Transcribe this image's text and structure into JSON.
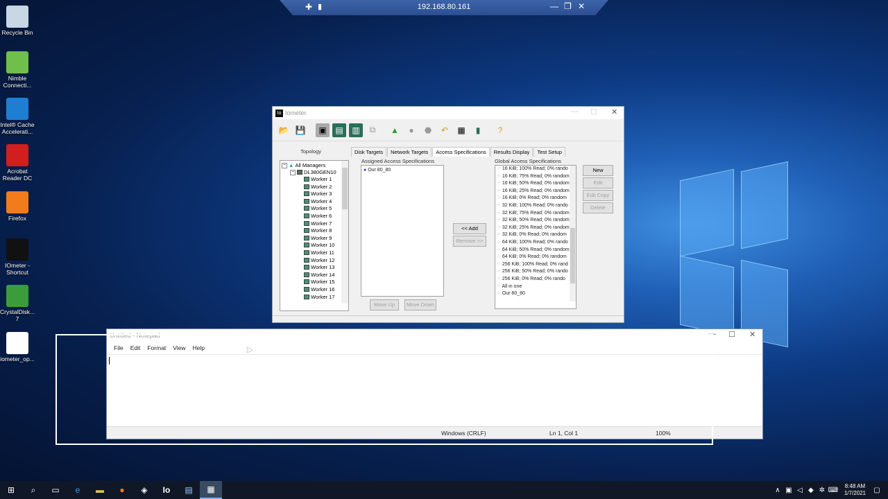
{
  "remote_bar": {
    "ip": "192.168.80.161",
    "pin_icon": "pin-icon",
    "signal_icon": "signal-icon"
  },
  "desktop_icons": [
    {
      "label": "Recycle Bin",
      "icon": "recycle-bin-icon",
      "color": "#c9d6e3"
    },
    {
      "label": "Nimble Connecti...",
      "icon": "nimble-icon",
      "color": "#6fbf4a"
    },
    {
      "label": "Intel® Cache Accelerati...",
      "icon": "intel-icon",
      "color": "#1e7fd2"
    },
    {
      "label": "Acrobat Reader DC",
      "icon": "acrobat-icon",
      "color": "#d11e1e"
    },
    {
      "label": "Firefox",
      "icon": "firefox-icon",
      "color": "#f27c1b"
    },
    {
      "label": "IOmeter - Shortcut",
      "icon": "iometer-icon",
      "color": "#111111"
    },
    {
      "label": "CrystalDisk... 7",
      "icon": "crystaldisk-icon",
      "color": "#3a9d3a"
    },
    {
      "label": "iometer_op...",
      "icon": "iometer-file-icon",
      "color": "#ffffff"
    }
  ],
  "iometer": {
    "title": "Iometer",
    "topology_label": "Topology",
    "tabs": [
      "Disk Targets",
      "Network Targets",
      "Access Specifications",
      "Results Display",
      "Test Setup"
    ],
    "active_tab": "Access Specifications",
    "tree_root": "All Managers",
    "manager": "DL380GEN10",
    "workers": [
      "Worker 1",
      "Worker 2",
      "Worker 3",
      "Worker 4",
      "Worker 5",
      "Worker 6",
      "Worker 7",
      "Worker 8",
      "Worker 9",
      "Worker 10",
      "Worker 11",
      "Worker 12",
      "Worker 13",
      "Worker 14",
      "Worker 15",
      "Worker 16",
      "Worker 17"
    ],
    "assigned_label": "Assigned Access Specifications",
    "assigned": [
      "Our 80_80"
    ],
    "global_label": "Global Access Specifications",
    "global": [
      "16 KiB; 100% Read; 0% rando",
      "16 KiB; 75% Read; 0% random",
      "16 KiB; 50% Read; 0% random",
      "16 KiB; 25% Read; 0% random",
      "16 KiB; 0% Read; 0% random",
      "32 KiB; 100% Read; 0% rando",
      "32 KiB; 75% Read; 0% random",
      "32 KiB; 50% Read; 0% random",
      "32 KiB; 25% Read; 0% random",
      "32 KiB; 0% Read; 0% random",
      "64 KiB; 100% Read; 0% rando",
      "64 KiB; 50% Read; 0% random",
      "64 KiB; 0% Read; 0% random",
      "256 KiB; 100% Read; 0% rand",
      "256 KiB; 50% Read; 0% rando",
      "256 KiB; 0% Read; 0% rando",
      "All in one",
      "Our 80_80"
    ],
    "buttons": {
      "add": "<< Add",
      "remove": "Remove >>",
      "move_up": "Move Up",
      "move_down": "Move Down",
      "new": "New",
      "edit": "Edit",
      "edit_copy": "Edit Copy",
      "delete": "Delete"
    }
  },
  "notepad": {
    "title": "Untitled - Notepad",
    "menu": [
      "File",
      "Edit",
      "Format",
      "View",
      "Help"
    ],
    "status": {
      "line_ending": "Windows (CRLF)",
      "position": "Ln 1, Col 1",
      "zoom": "100%"
    }
  },
  "taskbar": {
    "items": [
      "start-icon",
      "search-icon",
      "task-view-icon",
      "edge-icon",
      "file-explorer-icon",
      "firefox-icon",
      "network-app-icon",
      "iometer-icon",
      "notepad-icon",
      "app-icon"
    ],
    "time": "8:48 AM",
    "date": "1/7/2021"
  }
}
